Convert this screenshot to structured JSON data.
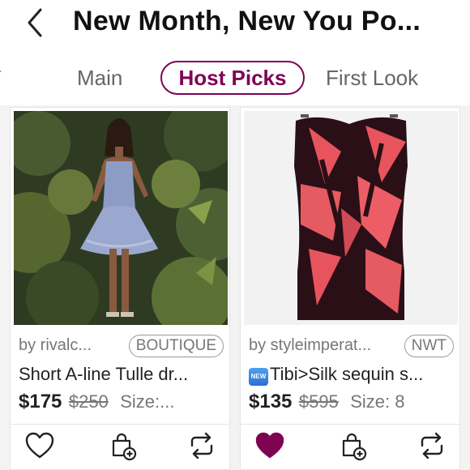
{
  "header": {
    "title": "New Month, New You Po..."
  },
  "tabs": {
    "partial": "T",
    "items": [
      "Main",
      "Host Picks",
      "First Look"
    ],
    "selected": "Host Picks"
  },
  "colors": {
    "brand": "#7f0353",
    "liked_heart": "#7f0353"
  },
  "listings": [
    {
      "seller": "by rivalc...",
      "badge": "BOUTIQUE",
      "title": "Short A-line Tulle dr...",
      "price": "$175",
      "original_price": "$250",
      "size": "Size:...",
      "liked": false,
      "actions": [
        "heart-icon",
        "bundle-icon",
        "share-icon"
      ]
    },
    {
      "seller": "by styleimperat...",
      "badge": "NWT",
      "new_icon": "NEW",
      "title": "Tibi>Silk sequin s...",
      "price": "$135",
      "original_price": "$595",
      "size": "Size: 8",
      "liked": true,
      "actions": [
        "heart-filled-icon",
        "bundle-icon",
        "share-icon"
      ]
    }
  ]
}
